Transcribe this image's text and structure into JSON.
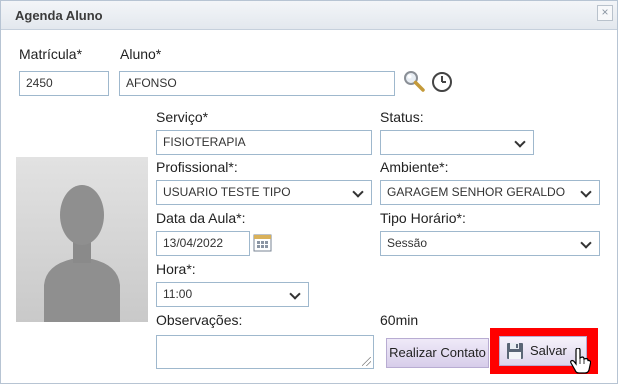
{
  "window": {
    "title": "Agenda Aluno",
    "close_glyph": "×"
  },
  "form": {
    "matricula": {
      "label": "Matrícula*",
      "value": "2450"
    },
    "aluno": {
      "label": "Aluno*",
      "value": "AFONSO"
    },
    "servico": {
      "label": "Serviço*",
      "value": "FISIOTERAPIA"
    },
    "status": {
      "label": "Status:",
      "value": ""
    },
    "profissional": {
      "label": "Profissional*:",
      "value": "USUARIO TESTE TIPO"
    },
    "ambiente": {
      "label": "Ambiente*:",
      "value": "GARAGEM SENHOR GERALDO"
    },
    "data_aula": {
      "label": "Data da Aula*:",
      "value": "13/04/2022"
    },
    "tipo_horario": {
      "label": "Tipo Horário*:",
      "value": "Sessão"
    },
    "hora": {
      "label": "Hora*:",
      "value": "11:00"
    },
    "observacoes": {
      "label": "Observações:",
      "value": ""
    },
    "duracao": "60min"
  },
  "actions": {
    "realizar_contato": "Realizar Contato",
    "salvar": "Salvar"
  },
  "icons": {
    "search": "search-icon",
    "history": "clock-icon",
    "calendar": "calendar-icon",
    "save": "floppy-disk-icon",
    "cursor": "hand-pointer-icon"
  },
  "colors": {
    "highlight": "#ff0000",
    "field_border": "#9fb8cd",
    "button_bg": "#d7cdea"
  }
}
